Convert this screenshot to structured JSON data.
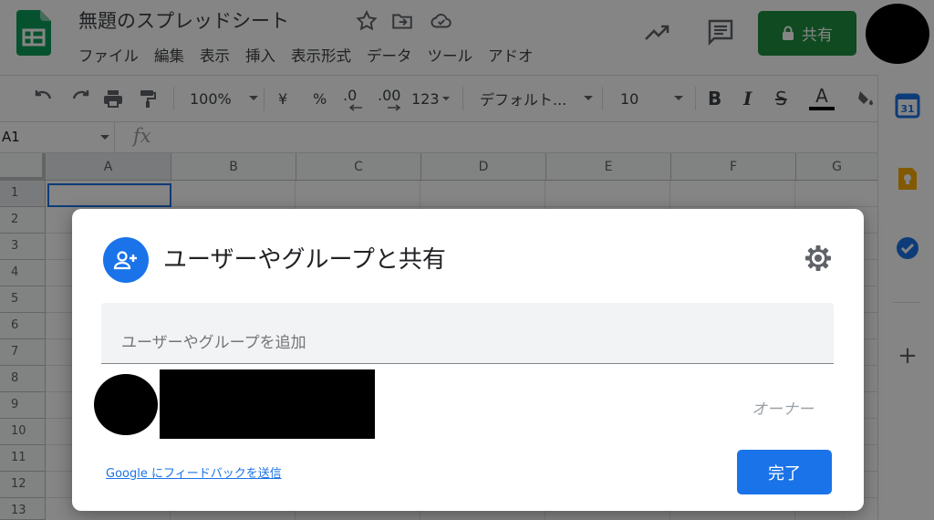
{
  "header": {
    "doc_title": "無題のスプレッドシート",
    "menu": [
      "ファイル",
      "編集",
      "表示",
      "挿入",
      "表示形式",
      "データ",
      "ツール",
      "アドオ"
    ],
    "share_label": "共有"
  },
  "toolbar": {
    "zoom": "100%",
    "currency": "¥",
    "percent": "%",
    "decimal_decrease": ".0",
    "decimal_increase": ".00",
    "number_format": "123",
    "font": "デフォルト...",
    "font_size": "10",
    "bold": "B",
    "italic": "I",
    "strike": "S",
    "text_color": "A"
  },
  "formula_bar": {
    "name_box": "A1",
    "fx": "fx"
  },
  "grid": {
    "columns": [
      "A",
      "B",
      "C",
      "D",
      "E",
      "F",
      "G"
    ],
    "rows": [
      "1",
      "2",
      "3",
      "4",
      "5",
      "6",
      "7",
      "8",
      "9",
      "10",
      "11",
      "12",
      "13"
    ],
    "active_cell": "A1"
  },
  "side_panel": {
    "calendar_day": "31",
    "add": "+"
  },
  "dialog": {
    "title": "ユーザーやグループと共有",
    "input_placeholder": "ユーザーやグループを追加",
    "owner_role": "オーナー",
    "feedback_link": "Google にフィードバックを送信",
    "done_label": "完了"
  },
  "colors": {
    "sheets_green": "#0f9d58",
    "share_green": "#1e8e3e",
    "accent_blue": "#1a73e8"
  }
}
